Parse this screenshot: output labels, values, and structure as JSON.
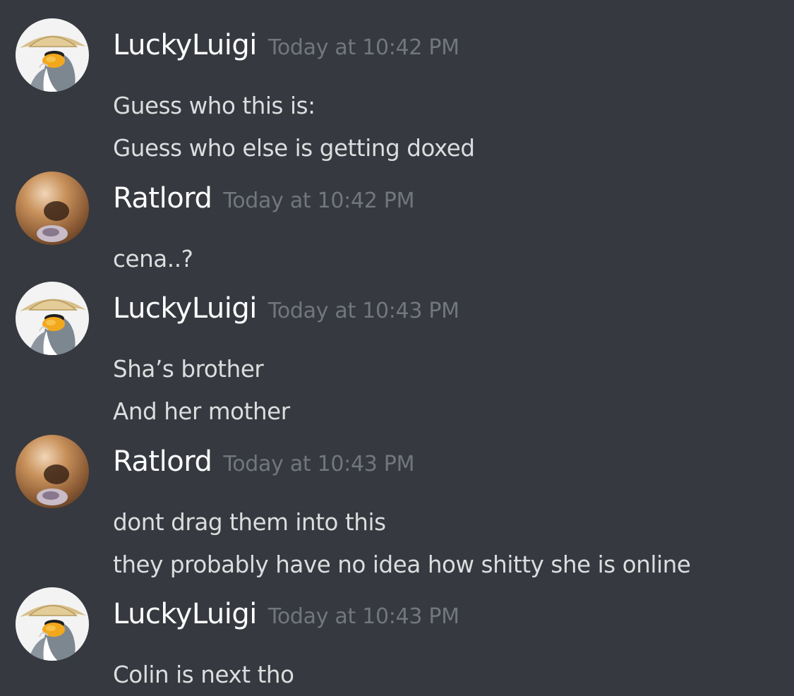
{
  "messages": [
    {
      "author": "LuckyLuigi",
      "avatar_icon": "penguin-rice-hat-avatar-icon",
      "timestamp": "Today at 10:42 PM",
      "lines": [
        "Guess who this is:",
        "Guess who else is getting doxed"
      ]
    },
    {
      "author": "Ratlord",
      "avatar_icon": "blurry-photo-avatar-icon",
      "timestamp": "Today at 10:42 PM",
      "lines": [
        "cena..?"
      ]
    },
    {
      "author": "LuckyLuigi",
      "avatar_icon": "penguin-rice-hat-avatar-icon",
      "timestamp": "Today at 10:43 PM",
      "lines": [
        "Sha’s brother",
        "And her mother"
      ]
    },
    {
      "author": "Ratlord",
      "avatar_icon": "blurry-photo-avatar-icon",
      "timestamp": "Today at 10:43 PM",
      "lines": [
        "dont drag them into this",
        "they probably have no idea how shitty she is online"
      ]
    },
    {
      "author": "LuckyLuigi",
      "avatar_icon": "penguin-rice-hat-avatar-icon",
      "timestamp": "Today at 10:43 PM",
      "lines": [
        "Colin is next tho"
      ]
    }
  ],
  "colors": {
    "background": "#36393f",
    "username": "#ffffff",
    "timestamp": "#72767d",
    "message_text": "#dcddde"
  }
}
